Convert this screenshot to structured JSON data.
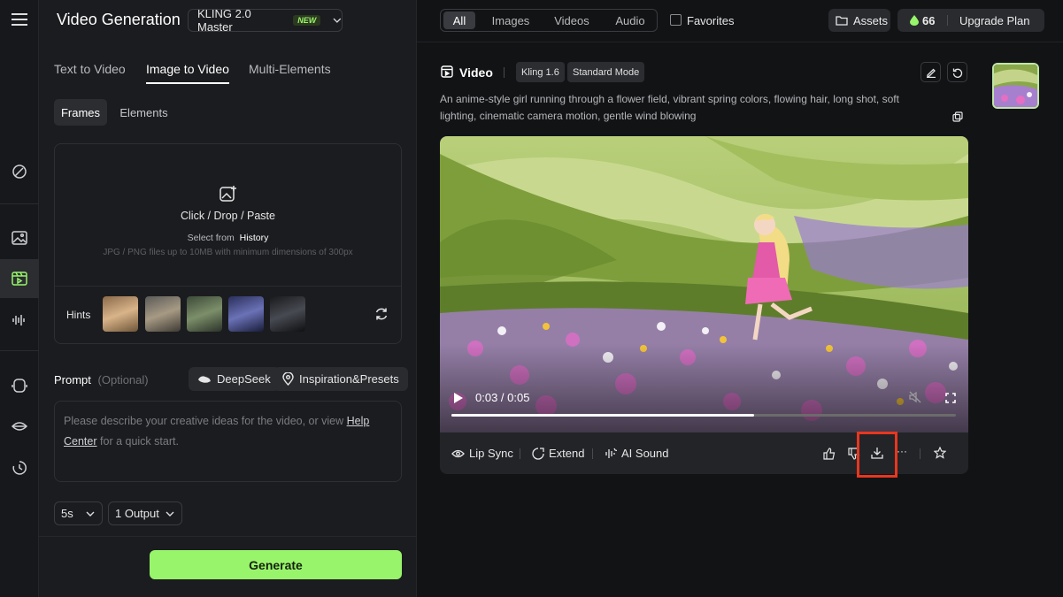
{
  "rail": {
    "icons": [
      "menu-icon",
      "magic-wand-icon",
      "image-icon",
      "video-icon",
      "audio-wave-icon",
      "avatar-icon",
      "lips-icon",
      "history-icon"
    ]
  },
  "panel": {
    "title": "Video Generation",
    "model": {
      "name": "KLING 2.0 Master",
      "badge": "NEW"
    },
    "tabs": [
      {
        "label": "Text to Video",
        "active": false
      },
      {
        "label": "Image to Video",
        "active": true
      },
      {
        "label": "Multi-Elements",
        "active": false
      }
    ],
    "subtabs": [
      {
        "label": "Frames",
        "active": true
      },
      {
        "label": "Elements",
        "active": false
      }
    ],
    "upload": {
      "main": "Click / Drop / Paste",
      "select_from": "Select from",
      "history": "History",
      "hint": "JPG / PNG files up to 10MB with minimum dimensions of 300px",
      "hints_label": "Hints"
    },
    "prompt": {
      "label": "Prompt",
      "optional": "(Optional)",
      "deepseek": "DeepSeek",
      "inspiration": "Inspiration&Presets",
      "placeholder_1": "Please describe your creative ideas for the video, or view",
      "help": "Help",
      "center": "Center",
      "placeholder_2": "for a quick start."
    },
    "duration": "5s",
    "outputs": "1 Output",
    "generate": "Generate"
  },
  "header": {
    "filters": [
      {
        "label": "All",
        "active": true
      },
      {
        "label": "Images",
        "active": false
      },
      {
        "label": "Videos",
        "active": false
      },
      {
        "label": "Audio",
        "active": false
      }
    ],
    "favorites": "Favorites",
    "assets": "Assets",
    "credits": "66",
    "upgrade": "Upgrade Plan"
  },
  "result": {
    "heading": "Video",
    "model_tag": "Kling 1.6",
    "mode_tag": "Standard Mode",
    "description": "An anime-style girl running through a flower field, vibrant spring colors, flowing hair, long shot, soft lighting, cinematic camera motion, gentle wind blowing",
    "time": "0:03 / 0:05",
    "progress": 0.6,
    "actions": {
      "lip_sync": "Lip Sync",
      "extend": "Extend",
      "ai_sound": "AI Sound",
      "more": "···"
    }
  },
  "colors": {
    "accent": "#98f56b",
    "highlight": "#e8371f"
  }
}
